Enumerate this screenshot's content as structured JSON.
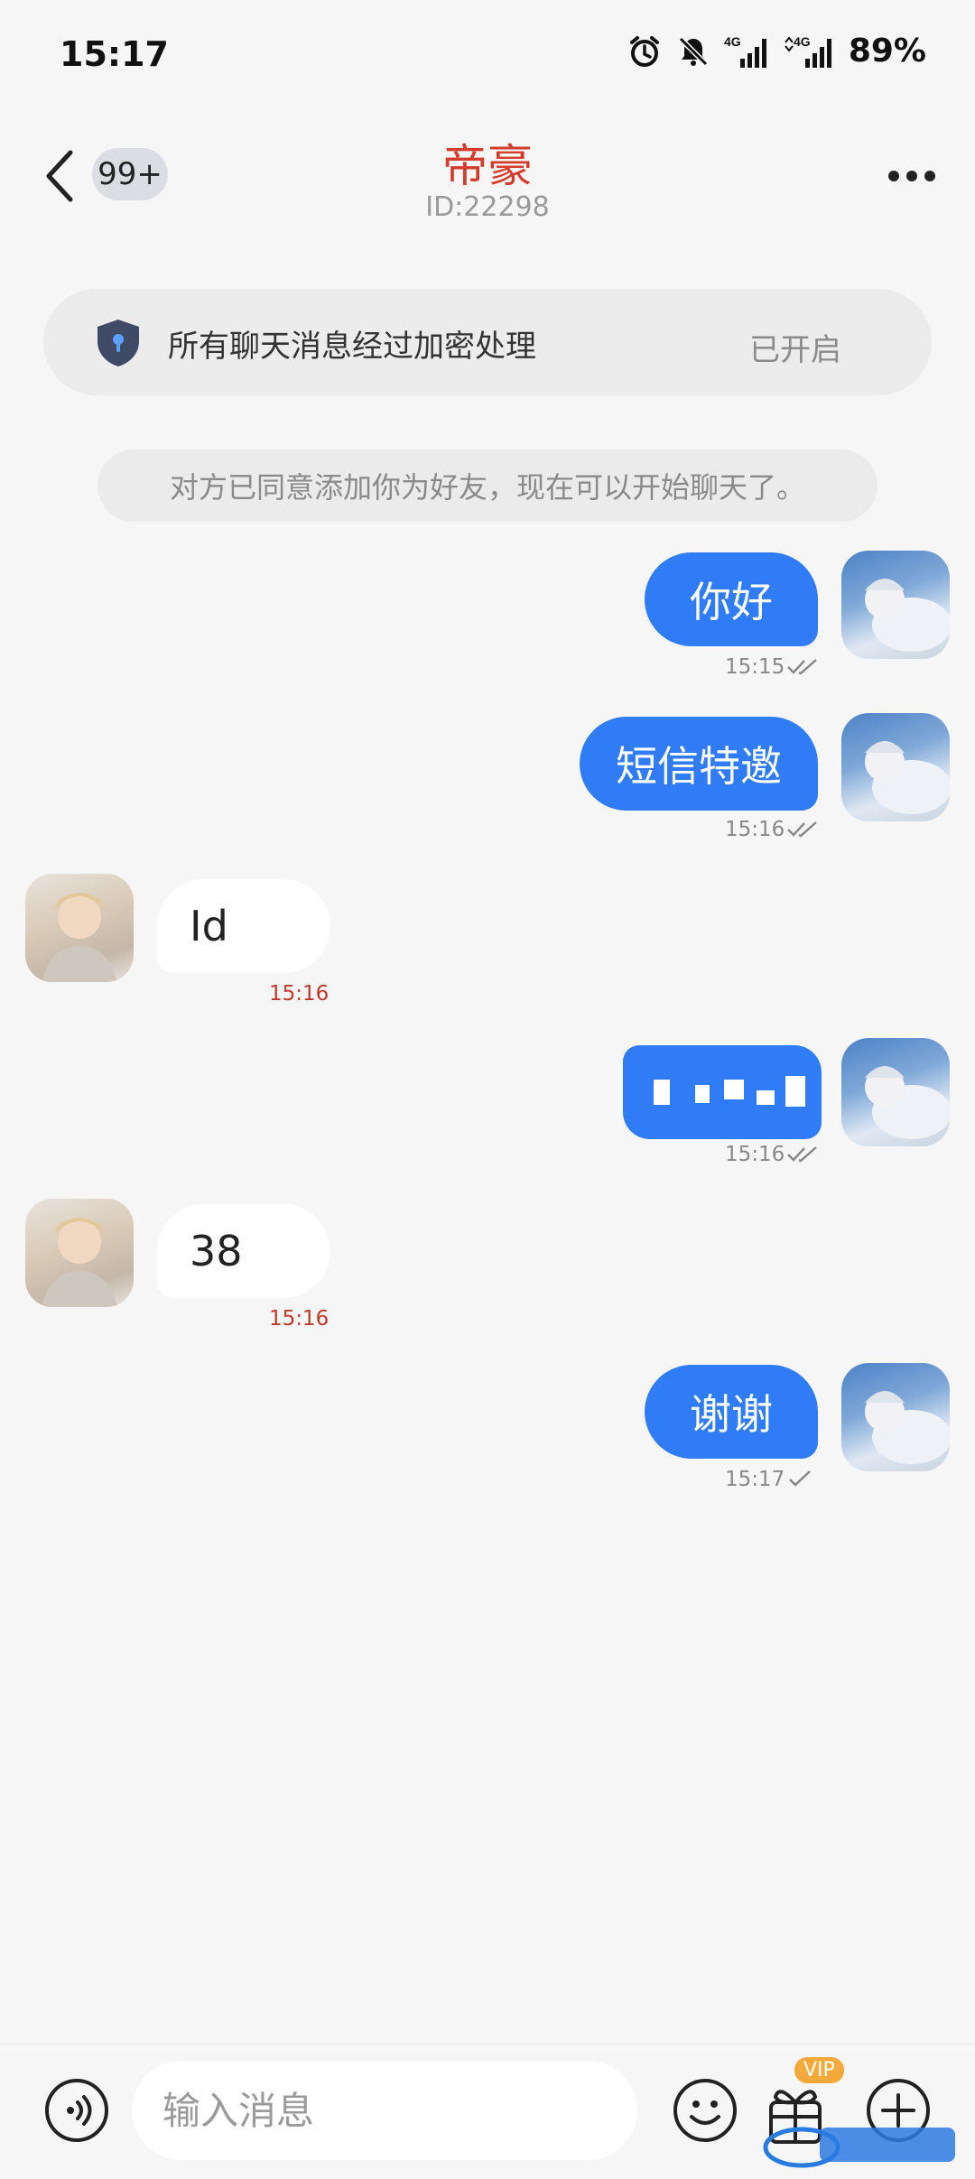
{
  "status_bar": {
    "time": "15:17",
    "network_1": "4G",
    "network_2": "4G",
    "battery": "89%",
    "icons": [
      "alarm-icon",
      "bell-muted-icon",
      "signal-icon",
      "signal-icon"
    ]
  },
  "header": {
    "unread_count": "99+",
    "title": "帝豪",
    "subtitle": "ID:22298",
    "title_color": "#d23c2c"
  },
  "encryption": {
    "text": "所有聊天消息经过加密处理",
    "status": "已开启"
  },
  "system_notice": "对方已同意添加你为好友，现在可以开始聊天了。",
  "messages": [
    {
      "from": "me",
      "text": "你好",
      "time": "15:15",
      "read": true
    },
    {
      "from": "me",
      "text": "短信特邀",
      "time": "15:16",
      "read": true
    },
    {
      "from": "other",
      "text": "Id",
      "time": "15:16"
    },
    {
      "from": "me",
      "text": "",
      "redacted": true,
      "time": "15:16",
      "read": true
    },
    {
      "from": "other",
      "text": "38",
      "time": "15:16"
    },
    {
      "from": "me",
      "text": "谢谢",
      "time": "15:17",
      "read": false
    }
  ],
  "input": {
    "placeholder": "输入消息",
    "vip_label": "VIP"
  },
  "colors": {
    "accent_blue": "#2f7cf6",
    "time_red": "#c0392b",
    "background": "#f6f6f6"
  }
}
